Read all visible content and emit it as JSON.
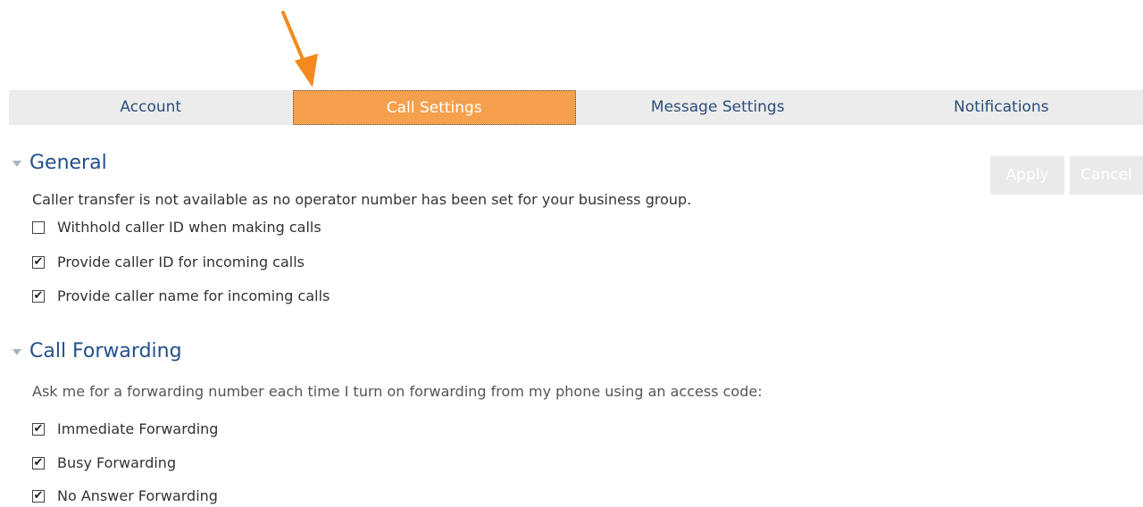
{
  "tabs": [
    {
      "label": "Account",
      "active": false
    },
    {
      "label": "Call Settings",
      "active": true
    },
    {
      "label": "Message Settings",
      "active": false
    },
    {
      "label": "Notifications",
      "active": false
    }
  ],
  "actions": {
    "apply_label": "Apply",
    "cancel_label": "Cancel"
  },
  "general": {
    "title": "General",
    "transfer_note": "Caller transfer is not available as no operator number has been set for your business group.",
    "options": [
      {
        "label": "Withhold caller ID when making calls",
        "checked": false
      },
      {
        "label": "Provide caller ID for incoming calls",
        "checked": true
      },
      {
        "label": "Provide caller name for incoming calls",
        "checked": true
      }
    ]
  },
  "call_forwarding": {
    "title": "Call Forwarding",
    "description": "Ask me for a forwarding number each time I turn on forwarding from my phone using an access code:",
    "options": [
      {
        "label": "Immediate Forwarding",
        "checked": true
      },
      {
        "label": "Busy Forwarding",
        "checked": true
      },
      {
        "label": "No Answer Forwarding",
        "checked": true
      }
    ]
  },
  "colors": {
    "active_tab": "#f5a04d",
    "tab_bar": "#ececec",
    "tab_text": "#2a4d7a",
    "section_title": "#23508a",
    "arrow": "#f28a1e"
  }
}
